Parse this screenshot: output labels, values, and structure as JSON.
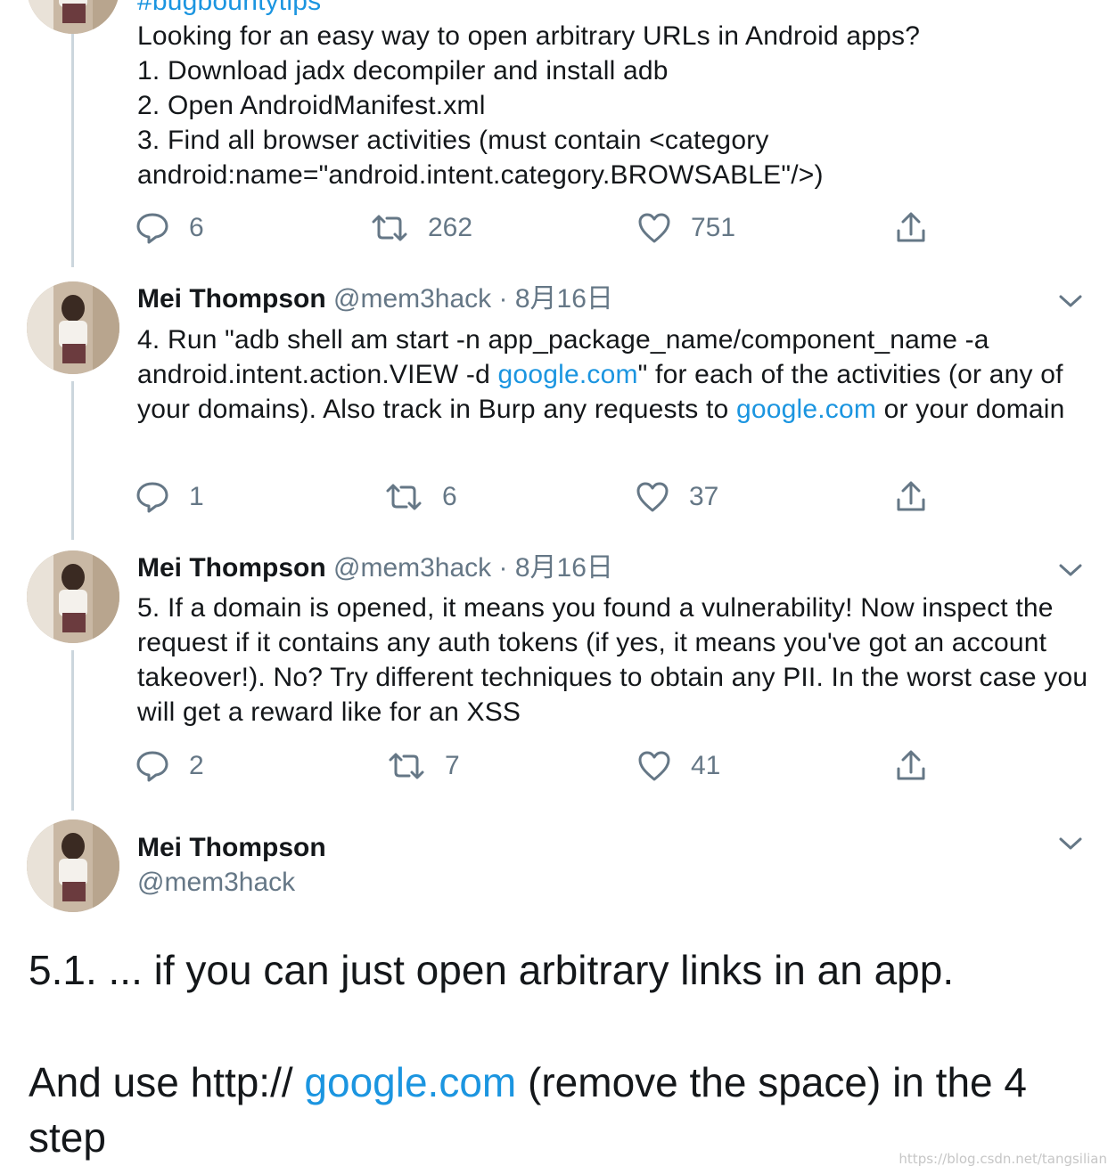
{
  "tweets": [
    {
      "hashtag": "#bugbountytips",
      "lines": [
        "Looking for an easy way to open arbitrary URLs in Android apps?",
        "1. Download jadx decompiler and install adb",
        "2. Open AndroidManifest.xml",
        "3. Find all browser activities (must contain <category android:name=\"android.intent.category.BROWSABLE\"/>)"
      ],
      "replies": "6",
      "retweets": "262",
      "likes": "751"
    },
    {
      "name": "Mei Thompson",
      "handle": "@mem3hack",
      "separator": "·",
      "date": "8月16日",
      "text_parts": [
        "4. Run \"adb shell am start -n app_package_name/component_name -a android.intent.action.VIEW -d ",
        "google.com",
        "\" for each of the activities (or any of your domains). Also track in Burp any requests to ",
        "google.com",
        " or your domain"
      ],
      "replies": "1",
      "retweets": "6",
      "likes": "37"
    },
    {
      "name": "Mei Thompson",
      "handle": "@mem3hack",
      "separator": "·",
      "date": "8月16日",
      "text": "5. If a domain is opened, it means you found a vulnerability! Now inspect the request if it contains any auth tokens (if yes, it means you've got an account takeover!). No? Try different techniques to obtain any PII. In the worst case you will get a reward like for an XSS",
      "replies": "2",
      "retweets": "7",
      "likes": "41"
    },
    {
      "name": "Mei Thompson",
      "handle": "@mem3hack",
      "paragraph1": "5.1. ... if you can just open arbitrary links in an app.",
      "paragraph2_parts": [
        "And use http:// ",
        "google.com",
        " (remove the space) in the 4 step"
      ]
    }
  ],
  "icons": {
    "reply": "reply-bubble-icon",
    "retweet": "retweet-arrows-icon",
    "like": "heart-icon",
    "share": "share-upload-icon",
    "more": "chevron-down-icon"
  },
  "colors": {
    "link": "#1b95e0",
    "secondary": "#657786",
    "text": "#14171a",
    "thread_line": "#ccd6dd"
  },
  "watermark": "https://blog.csdn.net/tangsilian"
}
